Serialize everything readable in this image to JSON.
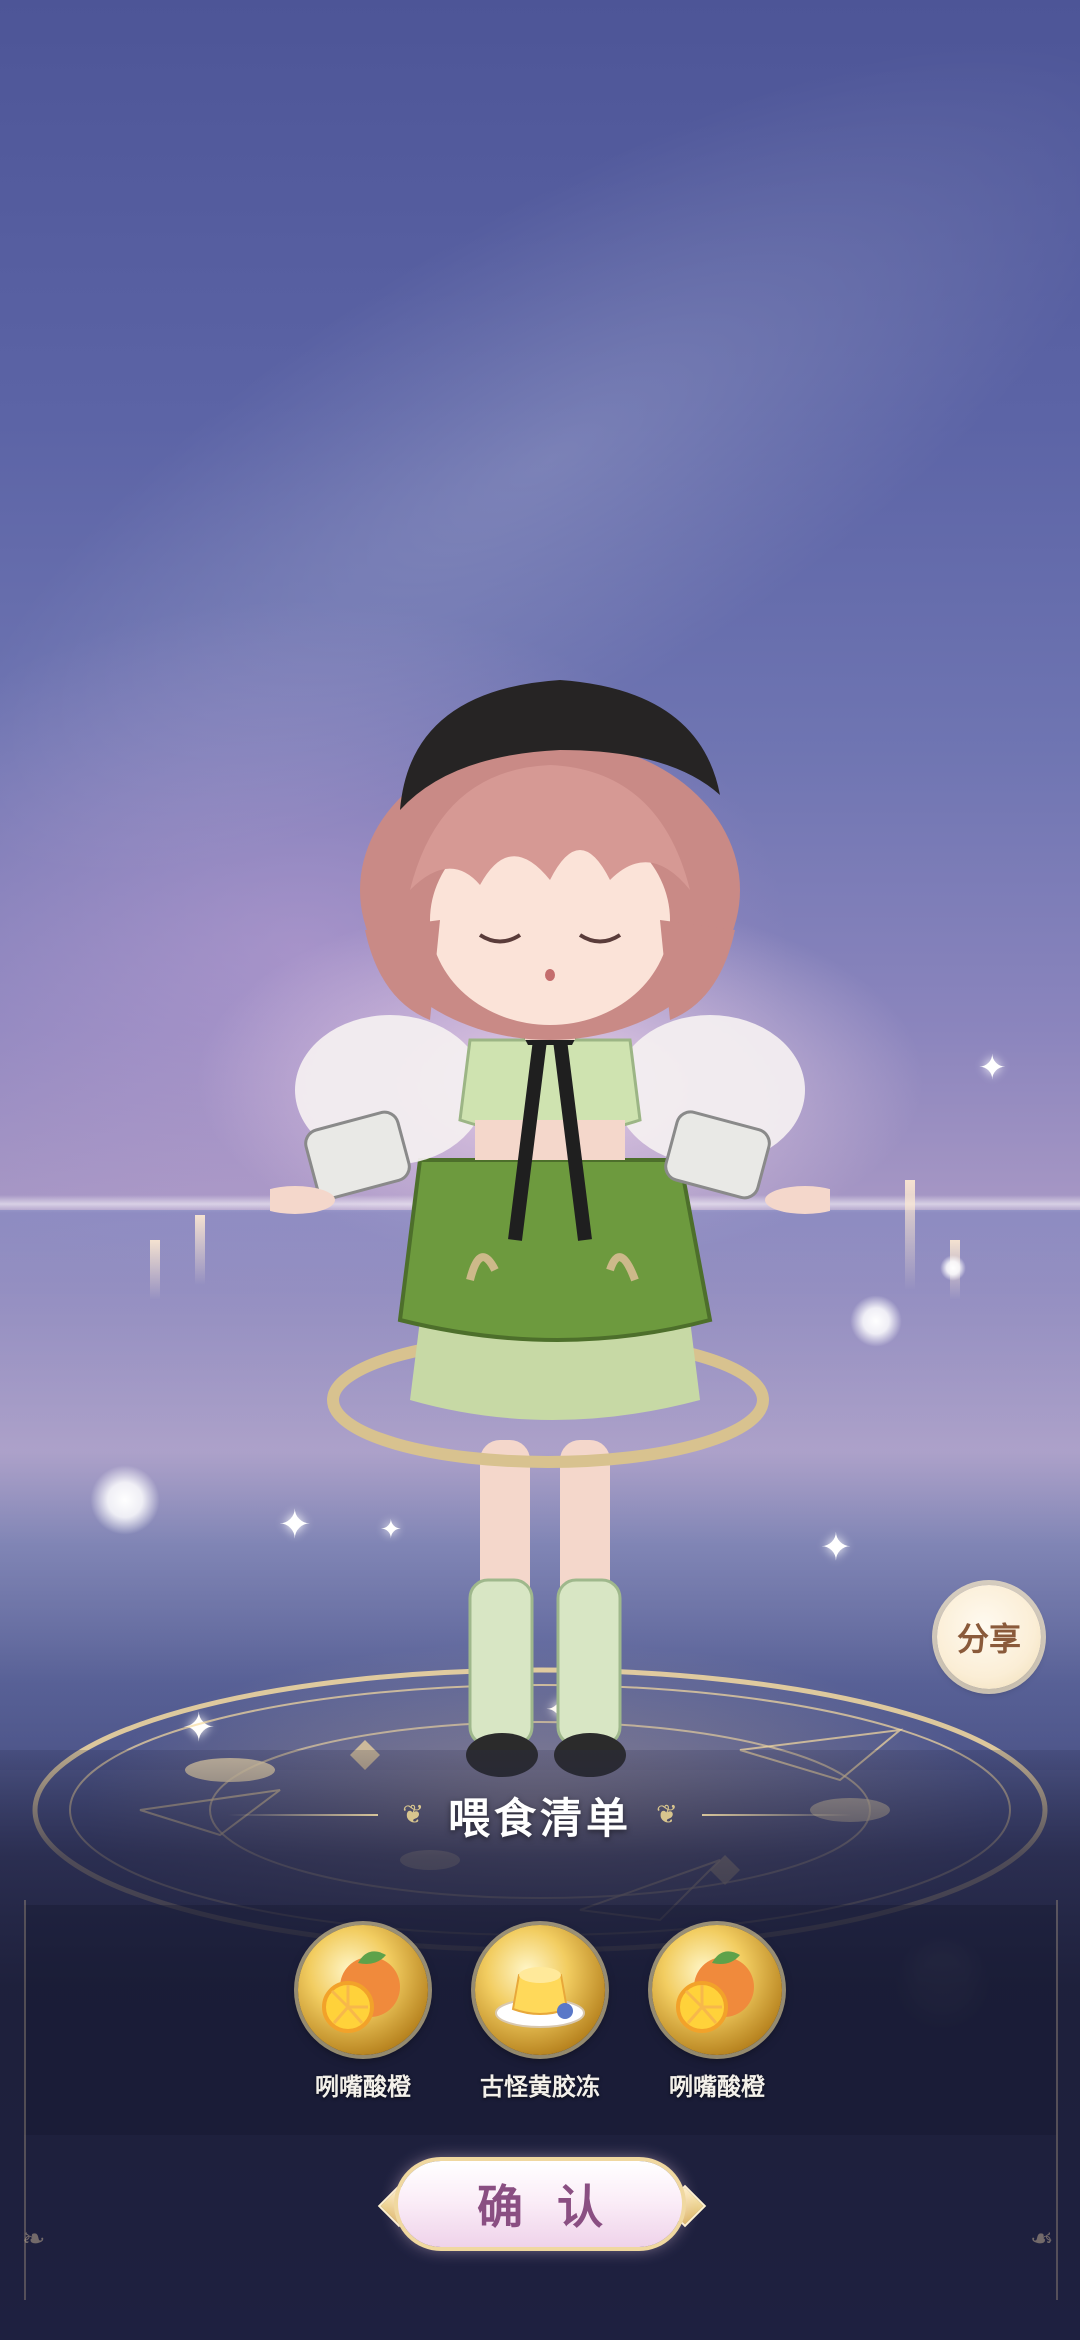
{
  "share": {
    "label": "分享"
  },
  "feeding_list": {
    "title": "喂食清单",
    "items": [
      {
        "name": "咧嘴酸橙",
        "icon": "orange-icon"
      },
      {
        "name": "古怪黄胶冻",
        "icon": "pudding-icon"
      },
      {
        "name": "咧嘴酸橙",
        "icon": "orange-icon"
      }
    ]
  },
  "confirm": {
    "label": "确认"
  },
  "colors": {
    "confirm_text": "#8a4f82",
    "gold_accent": "#d8c58e",
    "panel_bg": "#1e2040"
  }
}
